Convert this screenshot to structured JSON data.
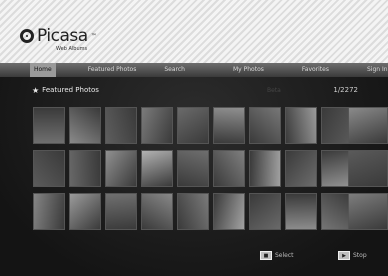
{
  "app": {
    "logo_text": "Picasa",
    "logo_tm": "™",
    "logo_subtitle": "Web Albums"
  },
  "nav": {
    "tabs": [
      {
        "label": "Home",
        "active": true
      },
      {
        "label": "Featured Photos",
        "active": false
      },
      {
        "label": "Search",
        "active": false
      },
      {
        "label": "My Photos",
        "active": false
      },
      {
        "label": "Favorites",
        "active": false
      },
      {
        "label": "Sign In",
        "active": false
      }
    ]
  },
  "panel": {
    "title": "Featured Photos",
    "faint_label": "Beta",
    "page_counter": "1/2272"
  },
  "photos": {
    "rows": [
      [
        "#6f6f6f",
        "#8a8a8a",
        "#5e5e5e",
        "#7b7b7b",
        "#6a6a6a",
        "#8f8f8f",
        "#777777",
        "#9a9a9a",
        "#5a5a5a",
        "#858585"
      ],
      [
        "#5b5b5b",
        "#676767",
        "#909090",
        "#b2b2b2",
        "#6e6e6e",
        "#7f7f7f",
        "#a0a0a0",
        "#6c6c6c",
        "#939393",
        "#787878"
      ],
      [
        "#858585",
        "#9b9b9b",
        "#707070",
        "#888888",
        "#7a7a7a",
        "#a3a3a3",
        "#696969",
        "#8c8c8c",
        "#757575",
        "#9f9f9f"
      ]
    ],
    "side_column": [
      "#8a8a8a",
      "#5a5a5a",
      "#7d7d7d"
    ]
  },
  "legend": {
    "items": [
      {
        "key": "■",
        "label": "Select"
      },
      {
        "key": "▶",
        "label": "Stop"
      }
    ]
  }
}
